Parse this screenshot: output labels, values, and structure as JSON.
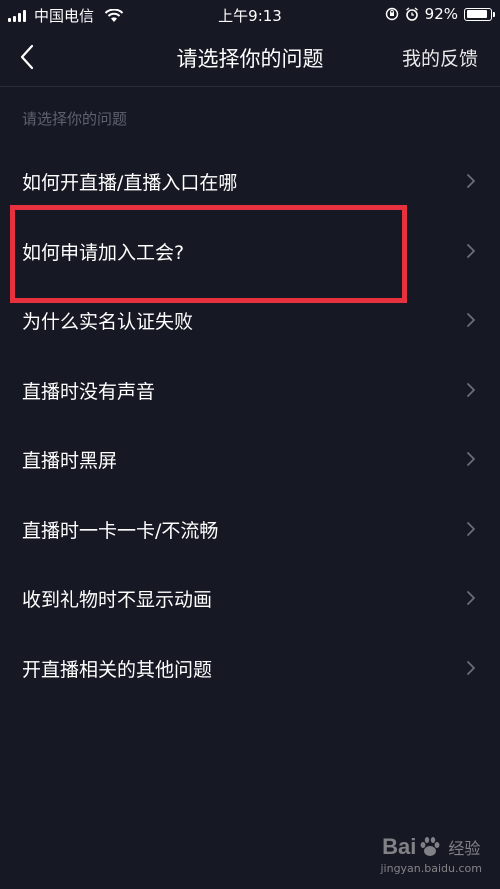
{
  "status_bar": {
    "carrier": "中国电信",
    "time": "上午9:13",
    "battery": "92%",
    "battery_level": 0.92
  },
  "nav": {
    "title": "请选择你的问题",
    "action": "我的反馈"
  },
  "section_header": "请选择你的问题",
  "questions": [
    {
      "label": "如何开直播/直播入口在哪"
    },
    {
      "label": "如何申请加入工会?"
    },
    {
      "label": "为什么实名认证失败"
    },
    {
      "label": "直播时没有声音"
    },
    {
      "label": "直播时黑屏"
    },
    {
      "label": "直播时一卡一卡/不流畅"
    },
    {
      "label": "收到礼物时不显示动画"
    },
    {
      "label": "开直播相关的其他问题"
    }
  ],
  "annotation": {
    "color": "#e8313f"
  },
  "watermark": {
    "brand": "Bai",
    "brand_suffix": "经验",
    "url": "jingyan.baidu.com"
  },
  "colors": {
    "background": "#161823",
    "text": "#ffffff",
    "secondary_text": "#5f6170"
  }
}
